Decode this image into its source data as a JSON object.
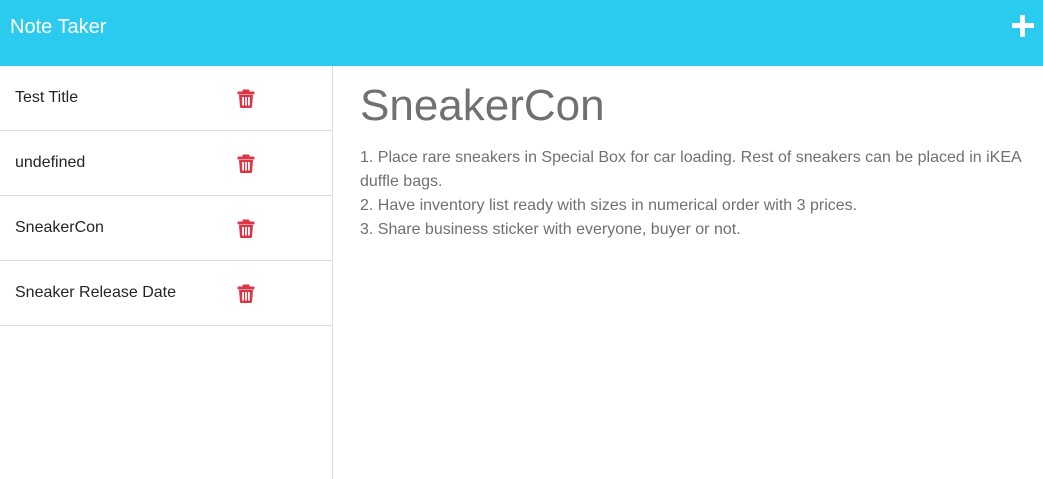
{
  "navbar": {
    "brand": "Note Taker",
    "new_note_icon": "plus-icon"
  },
  "notes": [
    {
      "title": "Test Title",
      "delete_icon": "trash-icon"
    },
    {
      "title": "undefined",
      "delete_icon": "trash-icon"
    },
    {
      "title": "SneakerCon",
      "delete_icon": "trash-icon"
    },
    {
      "title": "Sneaker Release Date",
      "delete_icon": "trash-icon"
    }
  ],
  "active_note": {
    "title": "SneakerCon",
    "text": "1. Place rare sneakers in Special Box for car loading. Rest of sneakers can be placed in iKEA duffle bags.\n2. Have inventory list ready with sizes in numerical order with 3 prices.\n3. Share business sticker with everyone, buyer or not."
  },
  "colors": {
    "navbar_bg": "#2bcbef",
    "delete_icon": "#dc3545",
    "note_text": "#707070"
  }
}
